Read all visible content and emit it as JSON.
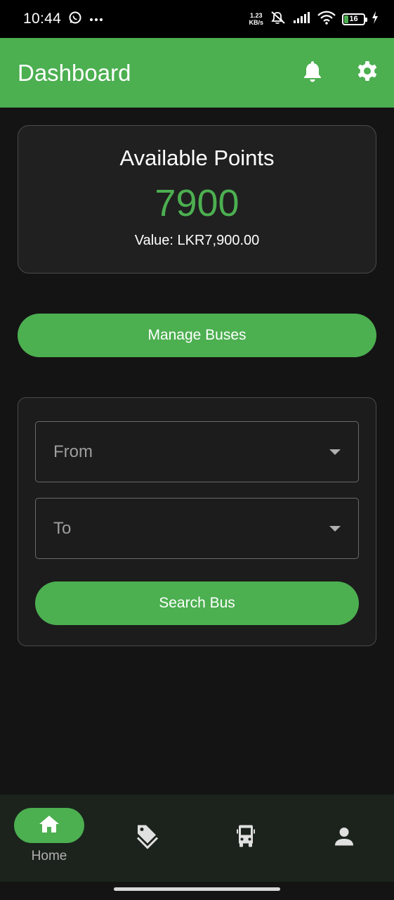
{
  "status_bar": {
    "time": "10:44",
    "net_speed_value": "1.23",
    "net_speed_unit": "KB/s",
    "battery": "16",
    "icons": [
      "whatsapp-icon",
      "more-dots-icon",
      "mute-icon",
      "signal-icon",
      "wifi-icon",
      "battery-icon",
      "charging-icon"
    ]
  },
  "app_bar": {
    "title": "Dashboard",
    "icons": [
      "bell-icon",
      "gear-icon"
    ]
  },
  "points_card": {
    "title": "Available Points",
    "points": "7900",
    "value_text": "Value: LKR7,900.00"
  },
  "manage_button": {
    "label": "Manage Buses"
  },
  "search": {
    "from_placeholder": "From",
    "to_placeholder": "To",
    "button_label": "Search Bus"
  },
  "bottom_nav": {
    "items": [
      {
        "label": "Home",
        "icon": "home-icon",
        "active": true
      },
      {
        "label": "",
        "icon": "tag-icon",
        "active": false
      },
      {
        "label": "",
        "icon": "bus-icon",
        "active": false
      },
      {
        "label": "",
        "icon": "person-icon",
        "active": false
      }
    ]
  },
  "colors": {
    "accent": "#4caf50",
    "background": "#141414",
    "card": "#202020",
    "nav_background": "#1b231c"
  }
}
